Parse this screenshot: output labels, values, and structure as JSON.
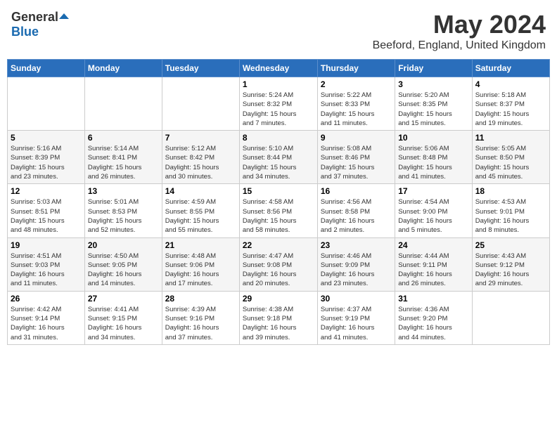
{
  "header": {
    "logo_general": "General",
    "logo_blue": "Blue",
    "month": "May 2024",
    "location": "Beeford, England, United Kingdom"
  },
  "weekdays": [
    "Sunday",
    "Monday",
    "Tuesday",
    "Wednesday",
    "Thursday",
    "Friday",
    "Saturday"
  ],
  "weeks": [
    [
      {
        "day": "",
        "info": ""
      },
      {
        "day": "",
        "info": ""
      },
      {
        "day": "",
        "info": ""
      },
      {
        "day": "1",
        "info": "Sunrise: 5:24 AM\nSunset: 8:32 PM\nDaylight: 15 hours\nand 7 minutes."
      },
      {
        "day": "2",
        "info": "Sunrise: 5:22 AM\nSunset: 8:33 PM\nDaylight: 15 hours\nand 11 minutes."
      },
      {
        "day": "3",
        "info": "Sunrise: 5:20 AM\nSunset: 8:35 PM\nDaylight: 15 hours\nand 15 minutes."
      },
      {
        "day": "4",
        "info": "Sunrise: 5:18 AM\nSunset: 8:37 PM\nDaylight: 15 hours\nand 19 minutes."
      }
    ],
    [
      {
        "day": "5",
        "info": "Sunrise: 5:16 AM\nSunset: 8:39 PM\nDaylight: 15 hours\nand 23 minutes."
      },
      {
        "day": "6",
        "info": "Sunrise: 5:14 AM\nSunset: 8:41 PM\nDaylight: 15 hours\nand 26 minutes."
      },
      {
        "day": "7",
        "info": "Sunrise: 5:12 AM\nSunset: 8:42 PM\nDaylight: 15 hours\nand 30 minutes."
      },
      {
        "day": "8",
        "info": "Sunrise: 5:10 AM\nSunset: 8:44 PM\nDaylight: 15 hours\nand 34 minutes."
      },
      {
        "day": "9",
        "info": "Sunrise: 5:08 AM\nSunset: 8:46 PM\nDaylight: 15 hours\nand 37 minutes."
      },
      {
        "day": "10",
        "info": "Sunrise: 5:06 AM\nSunset: 8:48 PM\nDaylight: 15 hours\nand 41 minutes."
      },
      {
        "day": "11",
        "info": "Sunrise: 5:05 AM\nSunset: 8:50 PM\nDaylight: 15 hours\nand 45 minutes."
      }
    ],
    [
      {
        "day": "12",
        "info": "Sunrise: 5:03 AM\nSunset: 8:51 PM\nDaylight: 15 hours\nand 48 minutes."
      },
      {
        "day": "13",
        "info": "Sunrise: 5:01 AM\nSunset: 8:53 PM\nDaylight: 15 hours\nand 52 minutes."
      },
      {
        "day": "14",
        "info": "Sunrise: 4:59 AM\nSunset: 8:55 PM\nDaylight: 15 hours\nand 55 minutes."
      },
      {
        "day": "15",
        "info": "Sunrise: 4:58 AM\nSunset: 8:56 PM\nDaylight: 15 hours\nand 58 minutes."
      },
      {
        "day": "16",
        "info": "Sunrise: 4:56 AM\nSunset: 8:58 PM\nDaylight: 16 hours\nand 2 minutes."
      },
      {
        "day": "17",
        "info": "Sunrise: 4:54 AM\nSunset: 9:00 PM\nDaylight: 16 hours\nand 5 minutes."
      },
      {
        "day": "18",
        "info": "Sunrise: 4:53 AM\nSunset: 9:01 PM\nDaylight: 16 hours\nand 8 minutes."
      }
    ],
    [
      {
        "day": "19",
        "info": "Sunrise: 4:51 AM\nSunset: 9:03 PM\nDaylight: 16 hours\nand 11 minutes."
      },
      {
        "day": "20",
        "info": "Sunrise: 4:50 AM\nSunset: 9:05 PM\nDaylight: 16 hours\nand 14 minutes."
      },
      {
        "day": "21",
        "info": "Sunrise: 4:48 AM\nSunset: 9:06 PM\nDaylight: 16 hours\nand 17 minutes."
      },
      {
        "day": "22",
        "info": "Sunrise: 4:47 AM\nSunset: 9:08 PM\nDaylight: 16 hours\nand 20 minutes."
      },
      {
        "day": "23",
        "info": "Sunrise: 4:46 AM\nSunset: 9:09 PM\nDaylight: 16 hours\nand 23 minutes."
      },
      {
        "day": "24",
        "info": "Sunrise: 4:44 AM\nSunset: 9:11 PM\nDaylight: 16 hours\nand 26 minutes."
      },
      {
        "day": "25",
        "info": "Sunrise: 4:43 AM\nSunset: 9:12 PM\nDaylight: 16 hours\nand 29 minutes."
      }
    ],
    [
      {
        "day": "26",
        "info": "Sunrise: 4:42 AM\nSunset: 9:14 PM\nDaylight: 16 hours\nand 31 minutes."
      },
      {
        "day": "27",
        "info": "Sunrise: 4:41 AM\nSunset: 9:15 PM\nDaylight: 16 hours\nand 34 minutes."
      },
      {
        "day": "28",
        "info": "Sunrise: 4:39 AM\nSunset: 9:16 PM\nDaylight: 16 hours\nand 37 minutes."
      },
      {
        "day": "29",
        "info": "Sunrise: 4:38 AM\nSunset: 9:18 PM\nDaylight: 16 hours\nand 39 minutes."
      },
      {
        "day": "30",
        "info": "Sunrise: 4:37 AM\nSunset: 9:19 PM\nDaylight: 16 hours\nand 41 minutes."
      },
      {
        "day": "31",
        "info": "Sunrise: 4:36 AM\nSunset: 9:20 PM\nDaylight: 16 hours\nand 44 minutes."
      },
      {
        "day": "",
        "info": ""
      }
    ]
  ]
}
